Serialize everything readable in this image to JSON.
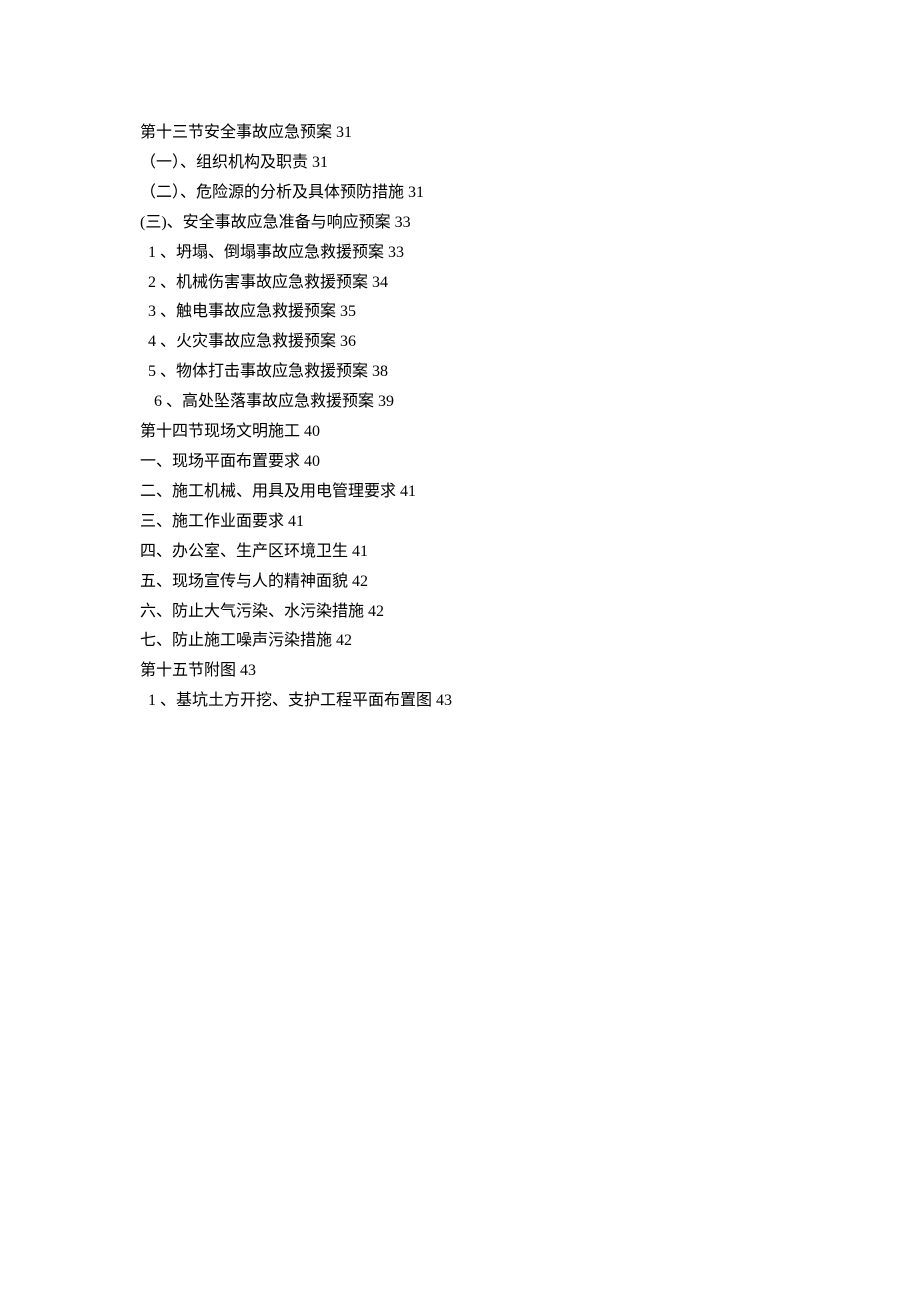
{
  "toc": {
    "lines": [
      {
        "text": "第十三节安全事故应急预案 31",
        "indent": 0
      },
      {
        "text": "（一）、组织机构及职责 31",
        "indent": 0
      },
      {
        "text": "（二）、危险源的分析及具体预防措施 31",
        "indent": 0
      },
      {
        "text": "(三)、安全事故应急准备与响应预案 33",
        "indent": 0
      },
      {
        "text": "1 、坍塌、倒塌事故应急救援预案 33",
        "indent": 1
      },
      {
        "text": "2 、机械伤害事故应急救援预案 34",
        "indent": 1
      },
      {
        "text": "3 、触电事故应急救援预案 35",
        "indent": 1
      },
      {
        "text": "4 、火灾事故应急救援预案 36",
        "indent": 1
      },
      {
        "text": "5 、物体打击事故应急救援预案 38",
        "indent": 1
      },
      {
        "text": "6 、高处坠落事故应急救援预案 39",
        "indent": 2
      },
      {
        "text": "第十四节现场文明施工 40",
        "indent": 0
      },
      {
        "text": "一、现场平面布置要求 40",
        "indent": 0
      },
      {
        "text": "二、施工机械、用具及用电管理要求 41",
        "indent": 0
      },
      {
        "text": "三、施工作业面要求 41",
        "indent": 0
      },
      {
        "text": "四、办公室、生产区环境卫生 41",
        "indent": 0
      },
      {
        "text": "五、现场宣传与人的精神面貌 42",
        "indent": 0
      },
      {
        "text": "六、防止大气污染、水污染措施 42",
        "indent": 0
      },
      {
        "text": "七、防止施工噪声污染措施 42",
        "indent": 0
      },
      {
        "text": "第十五节附图 43",
        "indent": 0
      },
      {
        "text": "1 、基坑土方开挖、支护工程平面布置图 43",
        "indent": 1
      }
    ]
  }
}
